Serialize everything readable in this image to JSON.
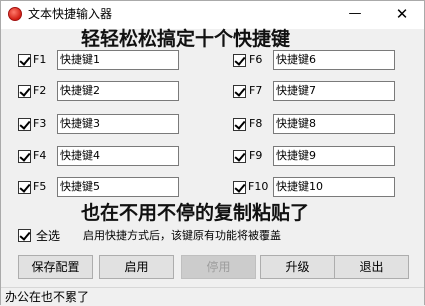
{
  "window": {
    "title": "文本快捷输入器",
    "minimize_glyph": "—",
    "close_glyph": "✕",
    "app_icon": "red-circle-icon"
  },
  "banner": {
    "top": "轻轻松松搞定十个快捷键",
    "middle": "也在不用不停的复制粘贴了"
  },
  "shortcuts": [
    {
      "key": "F1",
      "value": "快捷键1",
      "checked": true
    },
    {
      "key": "F2",
      "value": "快捷键2",
      "checked": true
    },
    {
      "key": "F3",
      "value": "快捷键3",
      "checked": true
    },
    {
      "key": "F4",
      "value": "快捷键4",
      "checked": true
    },
    {
      "key": "F5",
      "value": "快捷键5",
      "checked": true
    },
    {
      "key": "F6",
      "value": "快捷键6",
      "checked": true
    },
    {
      "key": "F7",
      "value": "快捷键7",
      "checked": true
    },
    {
      "key": "F8",
      "value": "快捷键8",
      "checked": true
    },
    {
      "key": "F9",
      "value": "快捷键9",
      "checked": true
    },
    {
      "key": "F10",
      "value": "快捷键10",
      "checked": true
    }
  ],
  "select_all": {
    "label": "全选",
    "checked": true
  },
  "hint": "启用快捷方式后，该键原有功能将被覆盖",
  "buttons": {
    "save": "保存配置",
    "enable": "启用",
    "disable": "停用",
    "upgrade": "升级",
    "exit": "退出"
  },
  "status": "办公在也不累了"
}
